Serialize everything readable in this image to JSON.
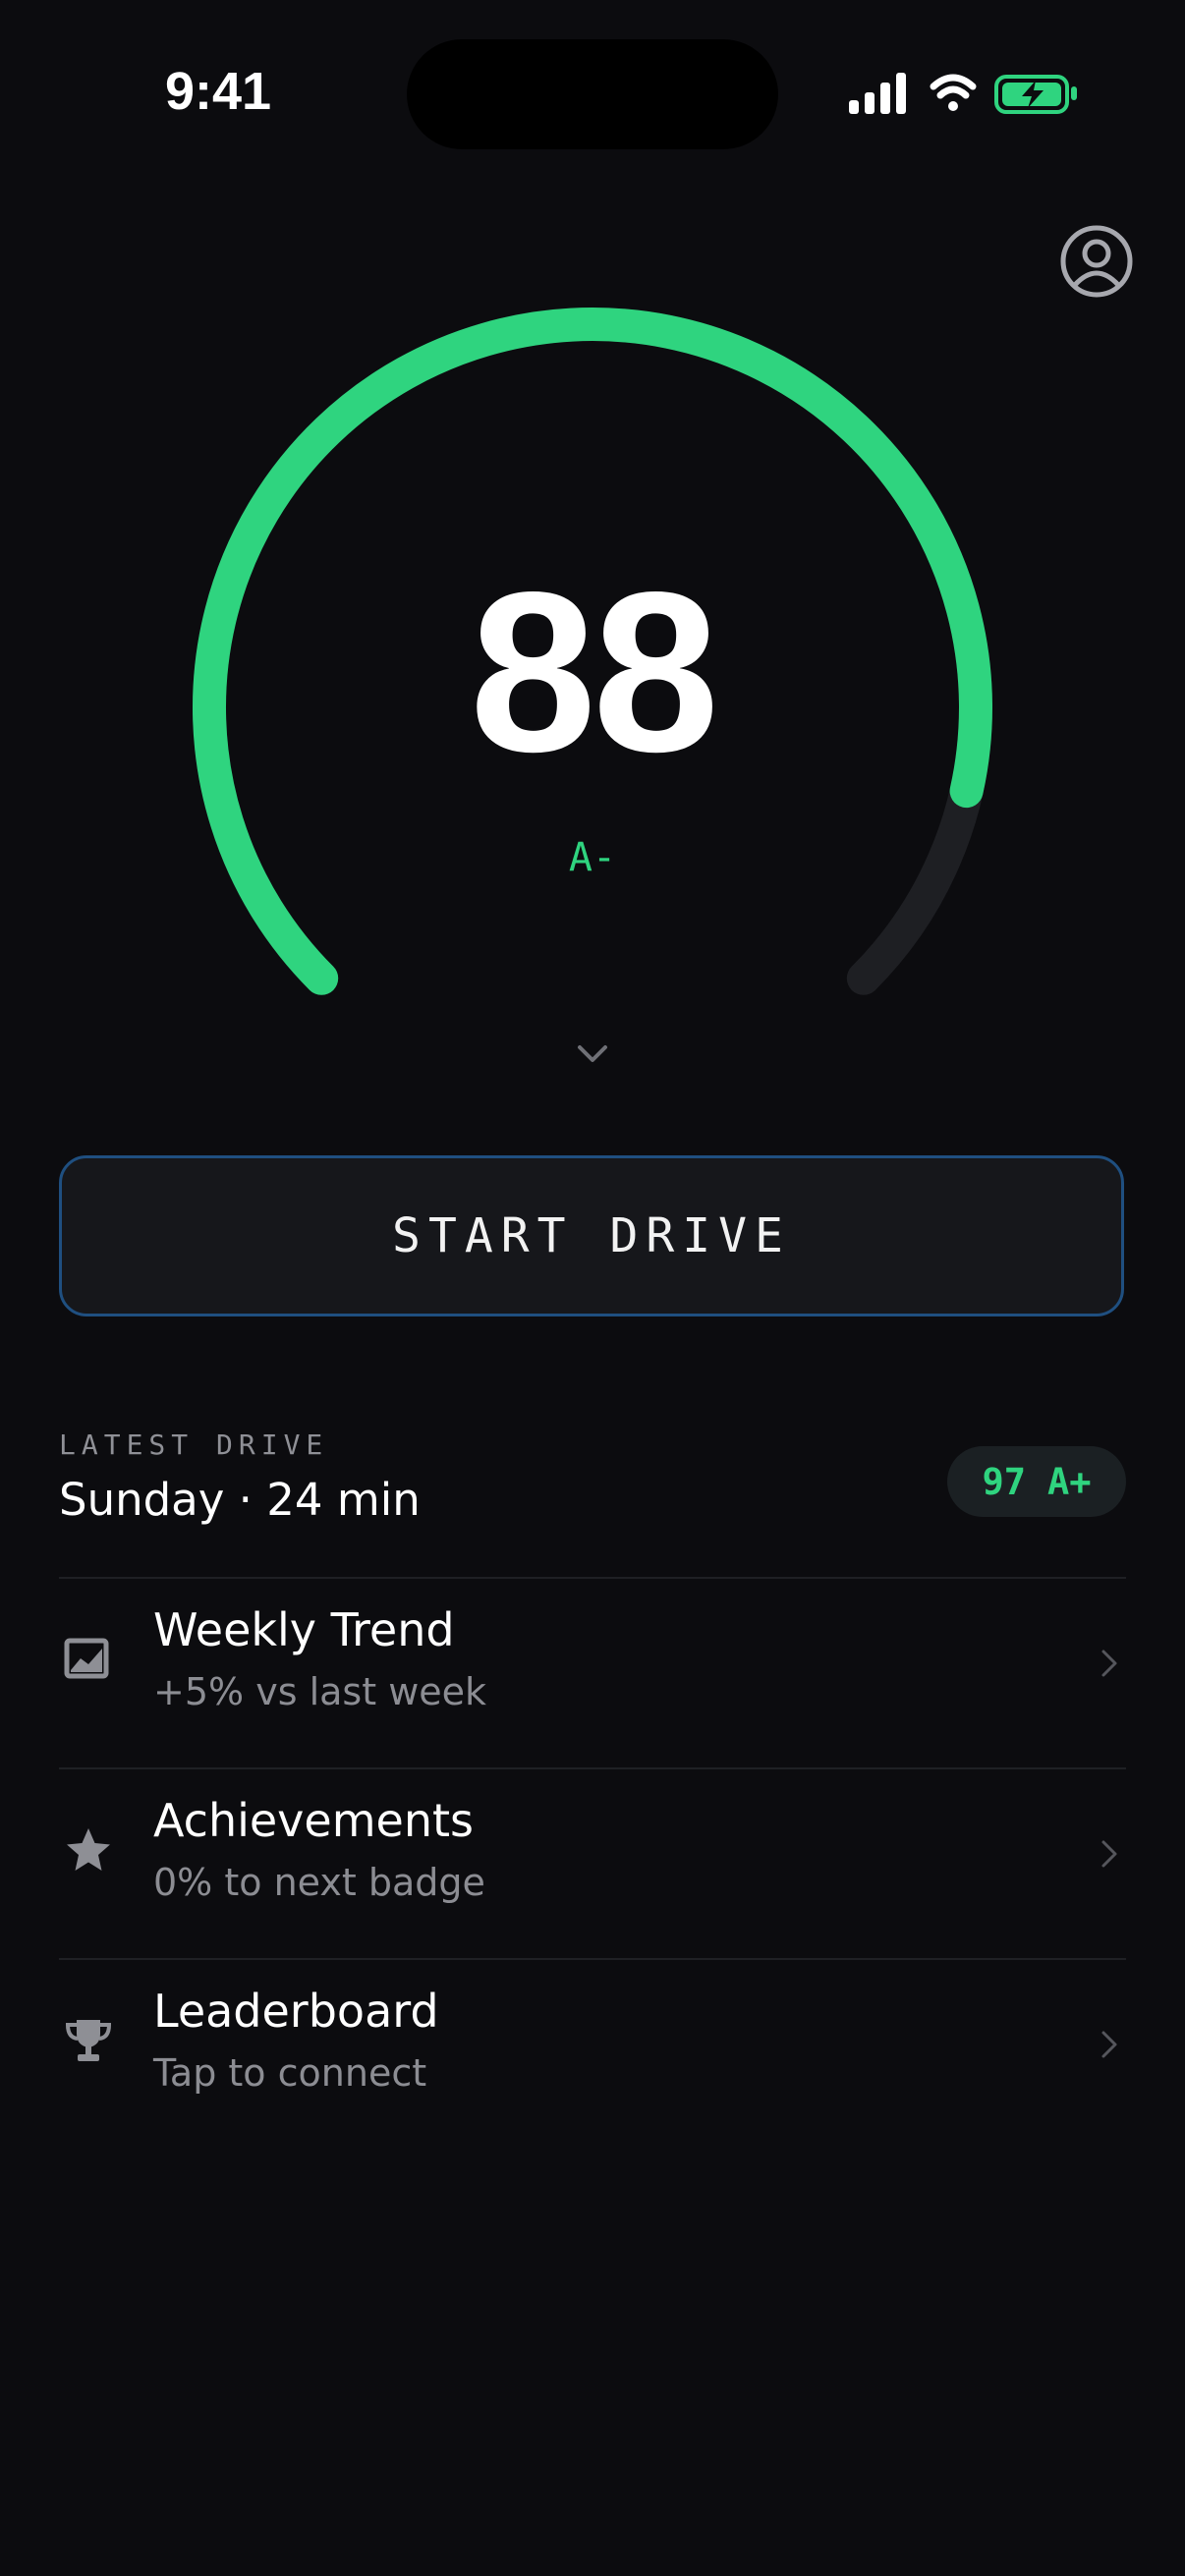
{
  "status_bar": {
    "time": "9:41"
  },
  "gauge": {
    "score": "88",
    "grade": "A-",
    "progress": 0.88
  },
  "primary_action": {
    "label": "START DRIVE"
  },
  "latest_drive": {
    "label": "LATEST DRIVE",
    "summary": "Sunday · 24 min",
    "score": "97",
    "grade": "A+"
  },
  "menu": {
    "items": [
      {
        "title": "Weekly Trend",
        "subtitle": "+5% vs last week",
        "icon": "trend-chart-icon"
      },
      {
        "title": "Achievements",
        "subtitle": "0% to next badge",
        "icon": "star-icon"
      },
      {
        "title": "Leaderboard",
        "subtitle": "Tap to connect",
        "icon": "trophy-icon"
      }
    ]
  },
  "colors": {
    "background": "#0c0c0f",
    "accent_green": "#2fd47f",
    "track": "#1e1f23",
    "button_border": "#1f4f80",
    "muted_text": "#8c8d93"
  }
}
